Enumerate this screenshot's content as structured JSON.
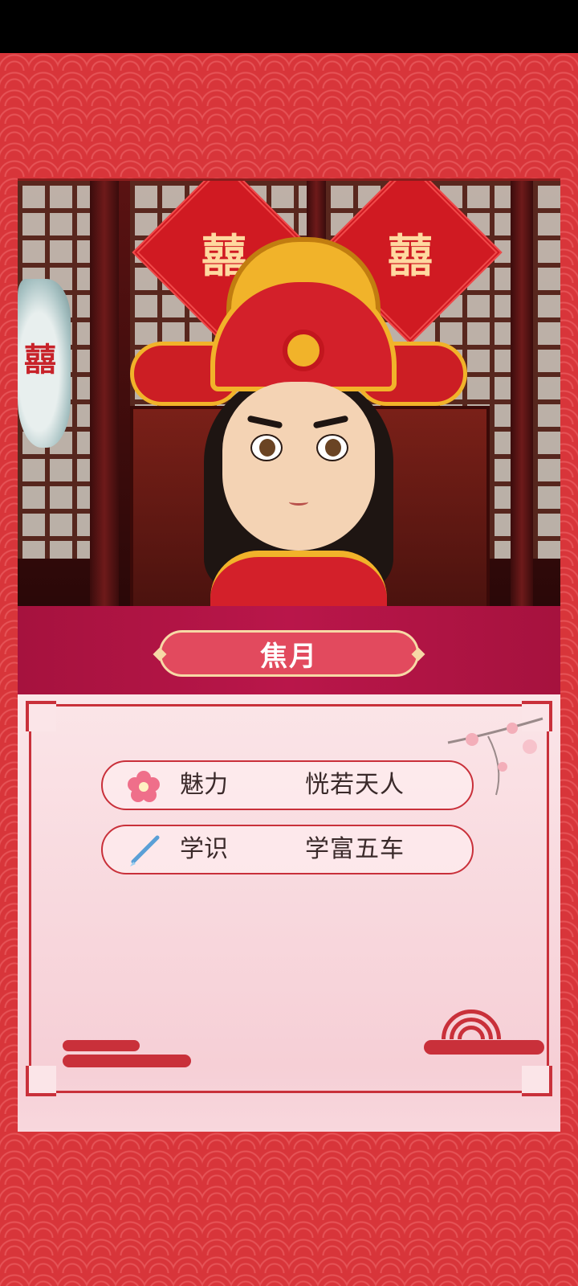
{
  "character": {
    "name": "焦月",
    "portrait_decorations": {
      "paper_cut_glyph": "囍"
    }
  },
  "stats": [
    {
      "icon": "plum-blossom-icon",
      "label": "魅力",
      "value": "恍若天人"
    },
    {
      "icon": "brush-pen-icon",
      "label": "学识",
      "value": "学富五车"
    }
  ],
  "colors": {
    "background_red": "#d8353a",
    "name_band": "#a6123e",
    "name_plate": "#e24a5e",
    "frame_red": "#c9303a",
    "panel_pink": "#fbe5e8"
  }
}
